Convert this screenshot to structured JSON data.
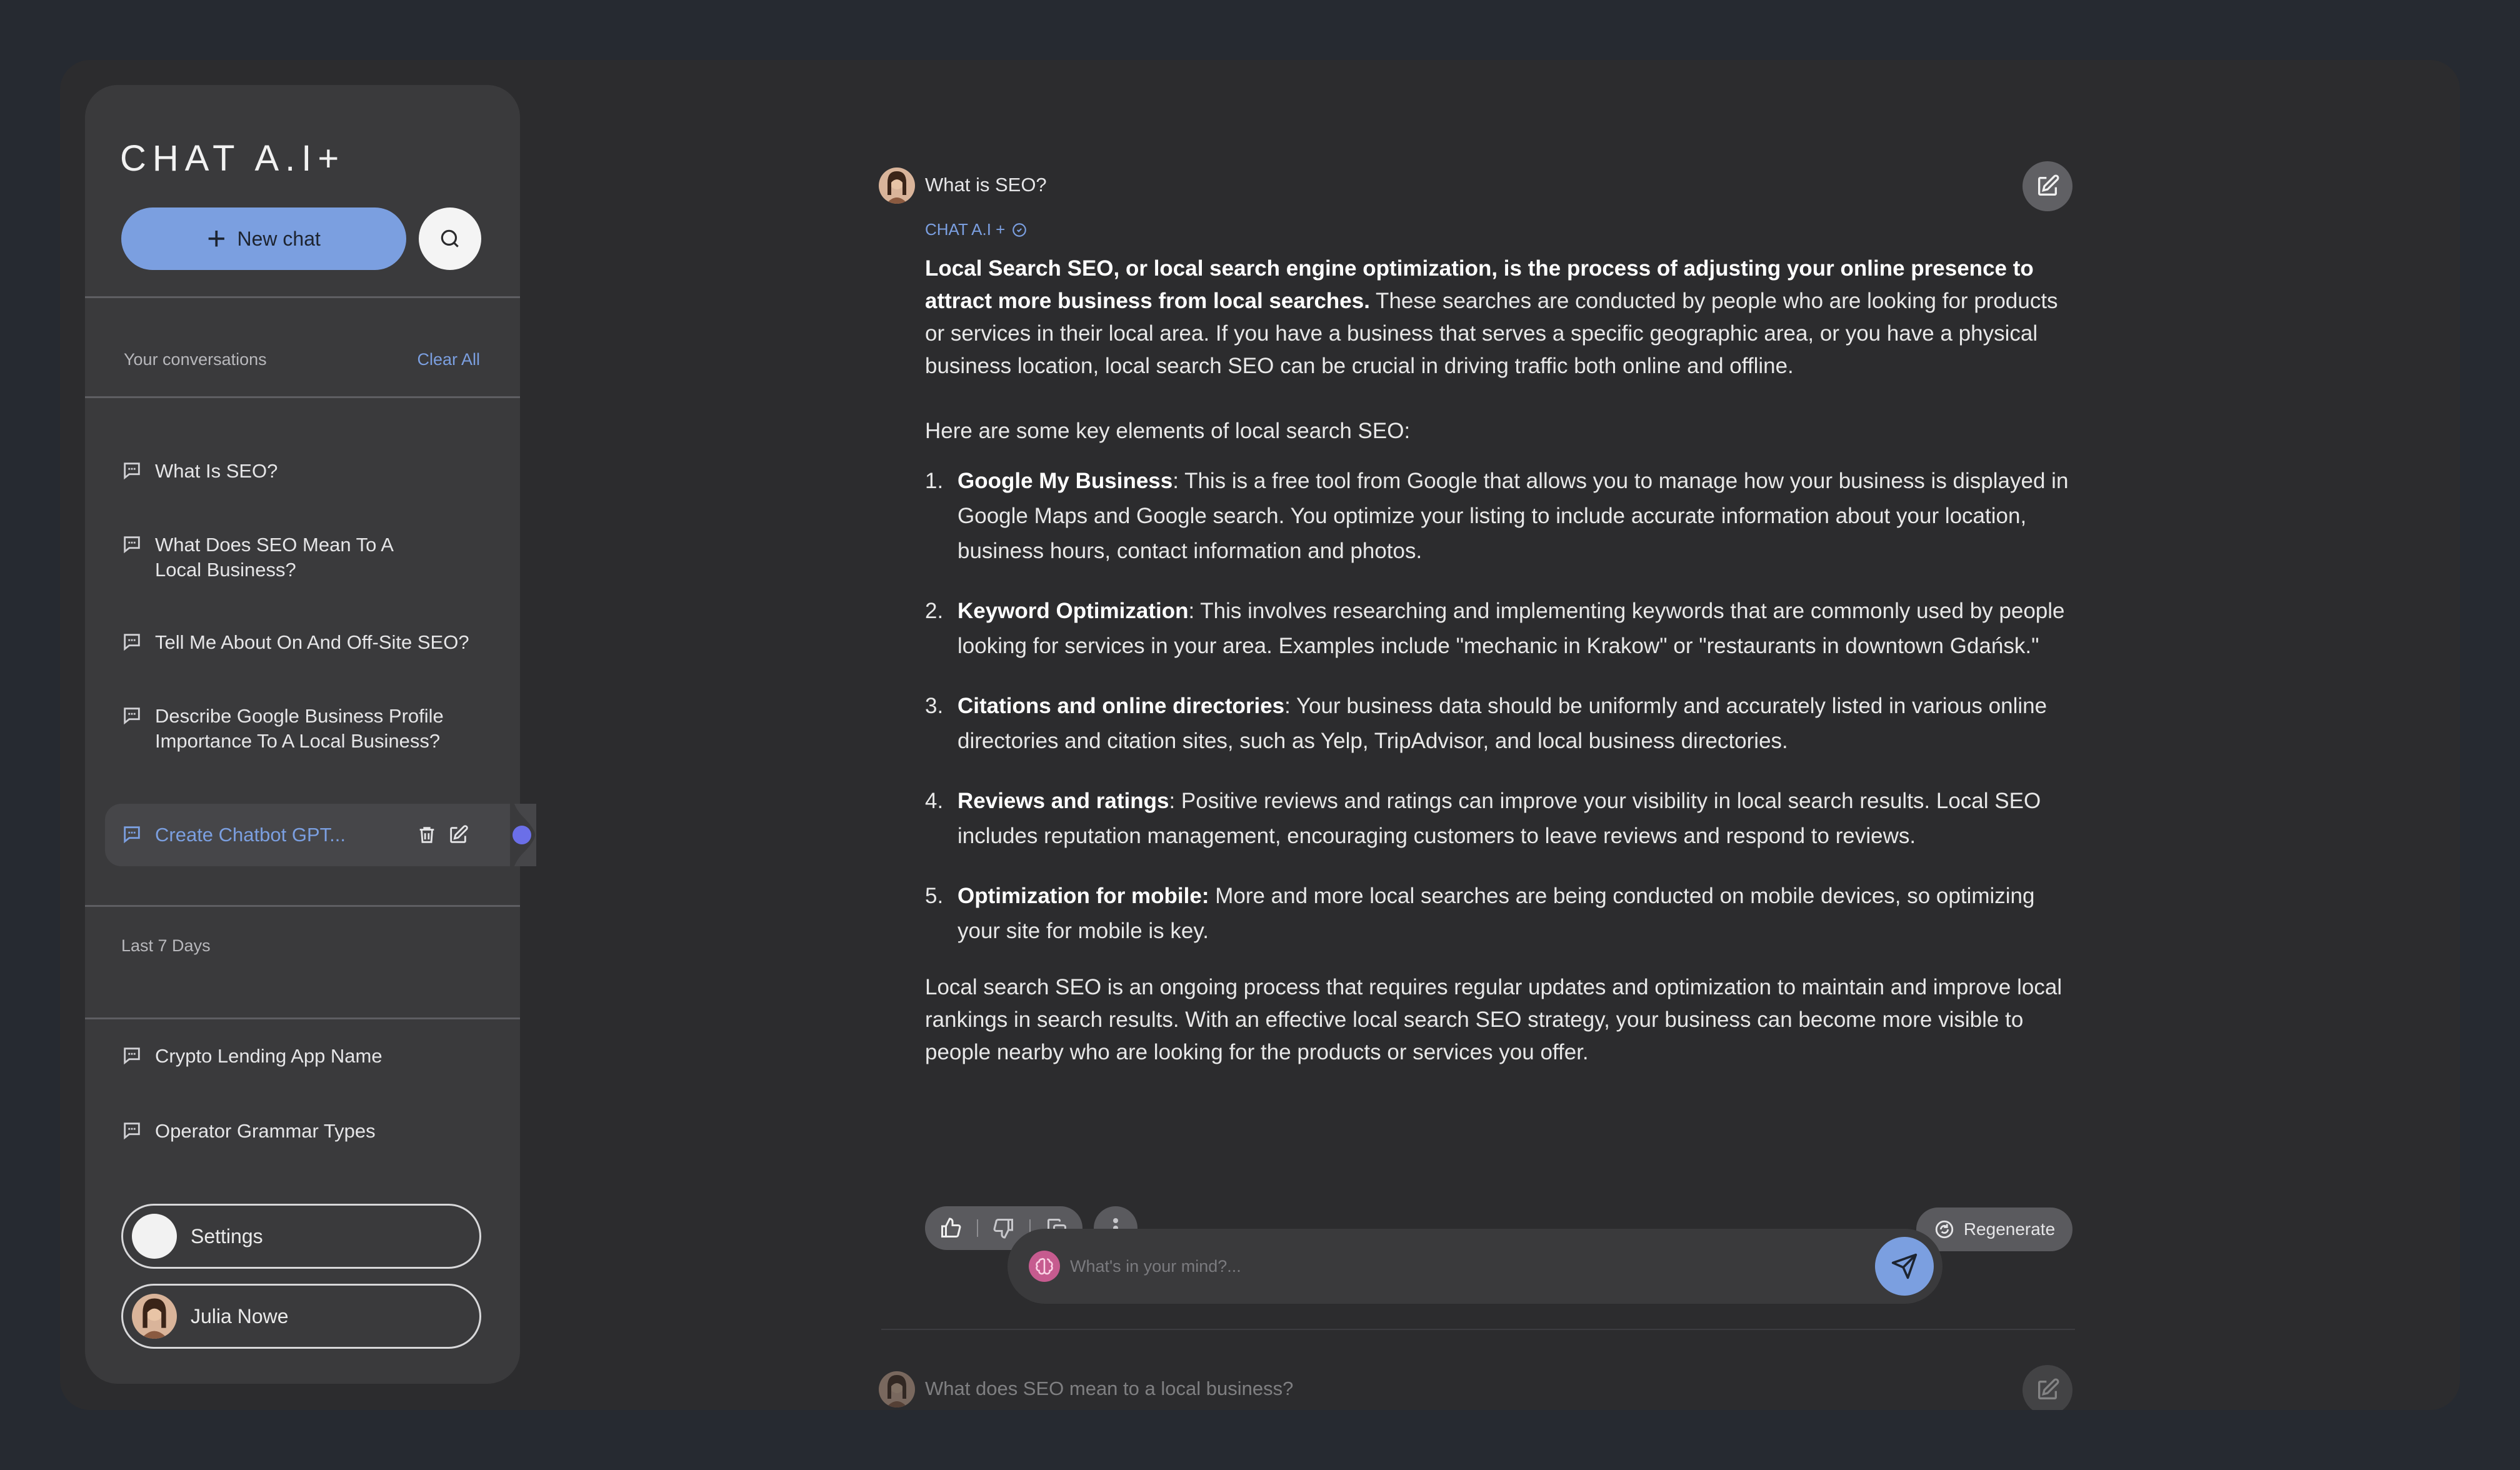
{
  "app": {
    "logo": "CHAT A.I+"
  },
  "sidebar": {
    "new_chat_label": "New chat",
    "conversations_label": "Your conversations",
    "clear_all_label": "Clear All",
    "conversations": [
      {
        "title": "What Is SEO?"
      },
      {
        "title_line1": "What Does SEO Mean To A",
        "title_line2": "Local Business?"
      },
      {
        "title": "Tell Me About On And Off-Site SEO?"
      },
      {
        "title_line1": "Describe Google Business Profile",
        "title_line2": "Importance To A Local Business?"
      },
      {
        "title": "Create Chatbot GPT...",
        "active": true
      }
    ],
    "last7_label": "Last 7 Days",
    "last7": [
      {
        "title": "Crypto Lending App Name"
      },
      {
        "title": "Operator Grammar Types"
      }
    ],
    "settings_label": "Settings",
    "user_name": "Julia Nowe"
  },
  "chat": {
    "question": "What is SEO?",
    "bot_label": "CHAT A.I +",
    "intro_bold": "Local Search SEO, or local search engine optimization, is the process of adjusting your online presence to attract more business from local searches.",
    "intro_rest": " These searches are conducted by people who are looking for products or services in their local area. If you have a business that serves a specific geographic area, or you have a physical business location, local search SEO can be crucial in driving traffic both online and offline.",
    "lead": "Here are some key elements of local search SEO:",
    "items": [
      {
        "num": "1.",
        "bold": "Google My Business",
        "text": ": This is a free tool from Google that allows you to manage how your business is displayed in Google Maps and Google search. You optimize your listing to include accurate information about your location, business hours, contact information and photos."
      },
      {
        "num": "2.",
        "bold": "Keyword Optimization",
        "text": ": This involves researching and implementing keywords that are commonly used by people looking for services in your area. Examples include \"mechanic in Krakow\" or \"restaurants in downtown Gdańsk.\""
      },
      {
        "num": "3.",
        "bold": "Citations and online directories",
        "text": ": Your business data should be uniformly and accurately listed in various online directories and citation sites, such as Yelp, TripAdvisor, and local business directories."
      },
      {
        "num": "4.",
        "bold": "Reviews and ratings",
        "text": ": Positive reviews and ratings can improve your visibility in local search results. Local SEO includes reputation management, encouraging customers to leave reviews and respond to reviews."
      },
      {
        "num": "5.",
        "bold": "Optimization for mobile:",
        "text": " More and more local searches are being conducted on mobile devices, so optimizing your site for mobile is key."
      }
    ],
    "conclusion": "Local search SEO is an ongoing process that requires regular updates and optimization to maintain and improve local rankings in search results. With an effective local search SEO strategy, your business can become more visible to people nearby who are looking for the products or services you offer.",
    "regenerate_label": "Regenerate",
    "input_placeholder": "What's in your mind?...",
    "next_question": "What does SEO mean to a local business?"
  },
  "colors": {
    "accent": "#7b9fe0",
    "active_dot": "#6b6fe8",
    "background": "#262a31",
    "panel": "#2c2c2e",
    "sidebar": "#3a3a3c"
  }
}
